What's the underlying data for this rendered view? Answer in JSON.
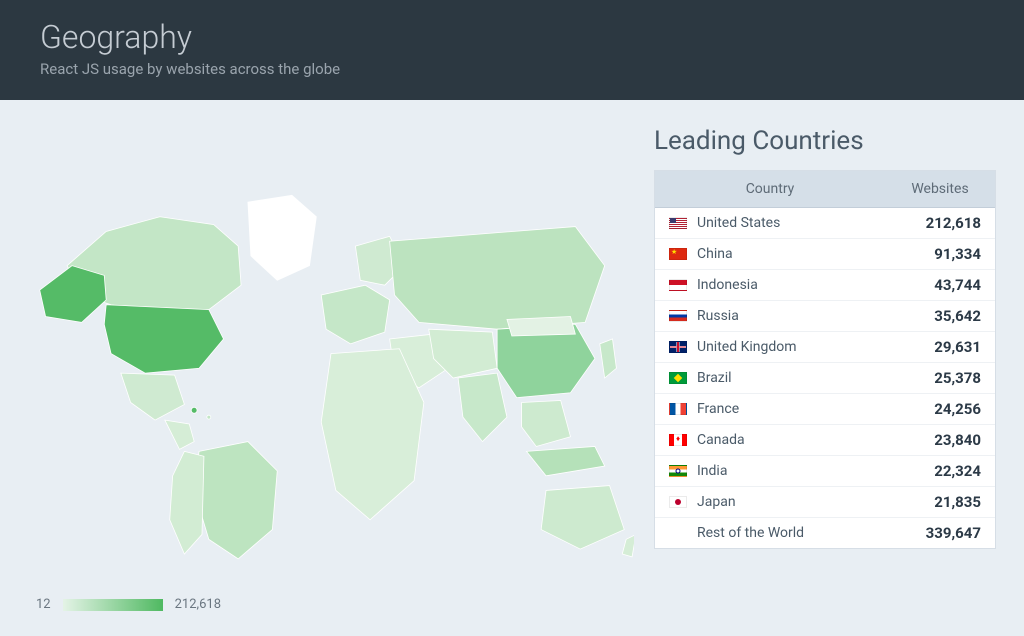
{
  "header": {
    "title": "Geography",
    "subtitle": "React JS usage by websites across the globe"
  },
  "legend": {
    "min": "12",
    "max": "212,618"
  },
  "table": {
    "title": "Leading Countries",
    "columns": {
      "country": "Country",
      "websites": "Websites"
    },
    "rows": [
      {
        "flag": "us",
        "country": "United States",
        "websites": "212,618"
      },
      {
        "flag": "cn",
        "country": "China",
        "websites": "91,334"
      },
      {
        "flag": "id",
        "country": "Indonesia",
        "websites": "43,744"
      },
      {
        "flag": "ru",
        "country": "Russia",
        "websites": "35,642"
      },
      {
        "flag": "gb",
        "country": "United Kingdom",
        "websites": "29,631"
      },
      {
        "flag": "br",
        "country": "Brazil",
        "websites": "25,378"
      },
      {
        "flag": "fr",
        "country": "France",
        "websites": "24,256"
      },
      {
        "flag": "ca",
        "country": "Canada",
        "websites": "23,840"
      },
      {
        "flag": "in",
        "country": "India",
        "websites": "22,324"
      },
      {
        "flag": "jp",
        "country": "Japan",
        "websites": "21,835"
      },
      {
        "flag": "",
        "country": "Rest of the World",
        "websites": "339,647"
      }
    ]
  },
  "chart_data": {
    "type": "choropleth-map",
    "title": "React JS usage by websites across the globe",
    "unit": "websites",
    "color_scale": {
      "min_value": 12,
      "max_value": 212618,
      "min_color": "#e4f3e6",
      "max_color": "#4fb961"
    },
    "series": [
      {
        "name": "United States",
        "value": 212618
      },
      {
        "name": "China",
        "value": 91334
      },
      {
        "name": "Indonesia",
        "value": 43744
      },
      {
        "name": "Russia",
        "value": 35642
      },
      {
        "name": "United Kingdom",
        "value": 29631
      },
      {
        "name": "Brazil",
        "value": 25378
      },
      {
        "name": "France",
        "value": 24256
      },
      {
        "name": "Canada",
        "value": 23840
      },
      {
        "name": "India",
        "value": 22324
      },
      {
        "name": "Japan",
        "value": 21835
      },
      {
        "name": "Rest of the World",
        "value": 339647
      }
    ]
  }
}
